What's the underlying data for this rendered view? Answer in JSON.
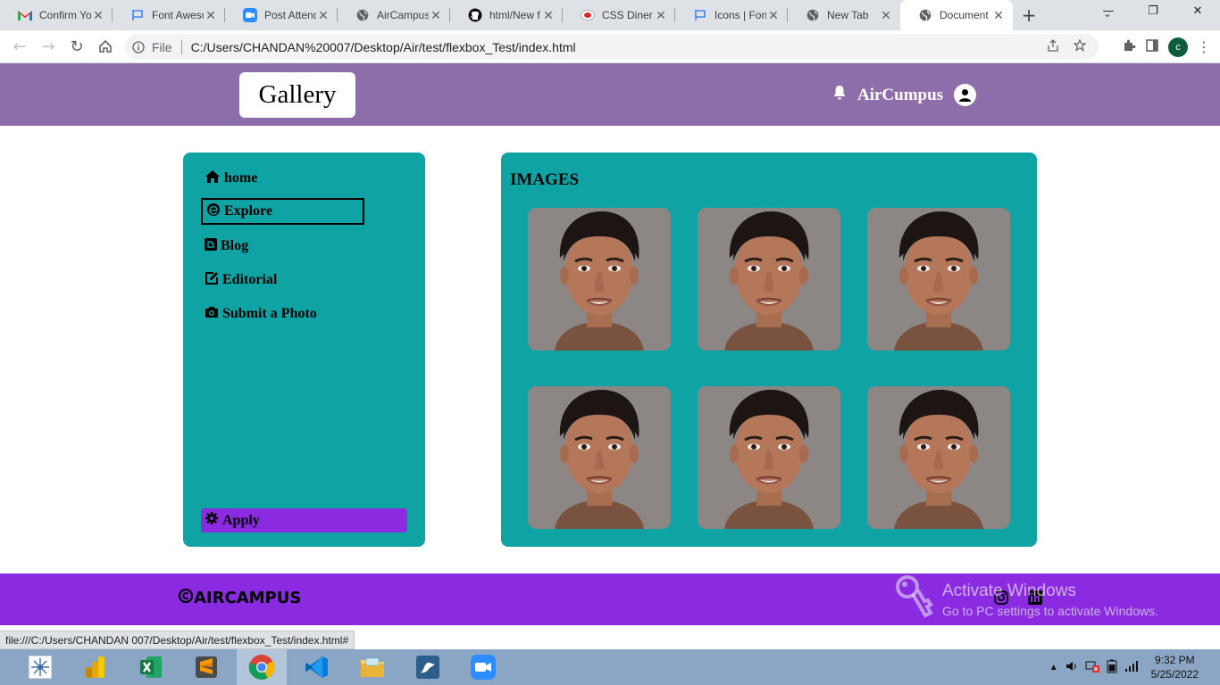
{
  "browser": {
    "tabs": [
      {
        "title": "Confirm You",
        "favicon": "gmail-icon"
      },
      {
        "title": "Font Aweso",
        "favicon": "flag-icon"
      },
      {
        "title": "Post Attend",
        "favicon": "zoom-icon"
      },
      {
        "title": "AirCampus",
        "favicon": "globe-icon"
      },
      {
        "title": "html/New f",
        "favicon": "github-icon"
      },
      {
        "title": "CSS Diner -",
        "favicon": "diner-icon"
      },
      {
        "title": "Icons | Font",
        "favicon": "flag-icon"
      },
      {
        "title": "New Tab",
        "favicon": "chrome-icon"
      },
      {
        "title": "Document",
        "favicon": "globe-icon",
        "active": true
      }
    ],
    "new_tab": "+",
    "address": {
      "scheme_label": "File",
      "url": "C:/Users/CHANDAN%20007/Desktop/Air/test/flexbox_Test/index.html"
    },
    "profile_initial": "c",
    "status_url": "file:///C:/Users/CHANDAN 007/Desktop/Air/test/flexbox_Test/index.html#"
  },
  "header": {
    "logo": "Gallery",
    "brand": "AirCumpus",
    "bg_color": "#8e6dab"
  },
  "sidebar": {
    "items": [
      {
        "label": "home",
        "icon": "home-icon"
      },
      {
        "label": "Explore",
        "icon": "edge-icon",
        "selected": true
      },
      {
        "label": "Blog",
        "icon": "blogger-icon"
      },
      {
        "label": "Editorial",
        "icon": "edit-icon"
      },
      {
        "label": "Submit a Photo",
        "icon": "camera-icon"
      }
    ],
    "apply_label": "Apply",
    "bg_color": "#10a3a3",
    "apply_color": "#8a2be2"
  },
  "main": {
    "title": "IMAGES",
    "photo_count": 6
  },
  "footer": {
    "logo": "AIRCAMPUS",
    "bg_color": "#8a2be2",
    "social": [
      "instagram-icon",
      "linkedin-icon"
    ]
  },
  "watermark": {
    "line1": "Activate Windows",
    "line2": "Go to PC settings to activate Windows."
  },
  "taskbar": {
    "apps": [
      "network-app-icon",
      "power-bi-icon",
      "excel-icon",
      "sublime-text-icon",
      "chrome-icon",
      "vscode-icon",
      "file-explorer-icon",
      "mysql-workbench-icon",
      "zoom-icon"
    ],
    "time": "9:32 PM",
    "date": "5/25/2022"
  }
}
